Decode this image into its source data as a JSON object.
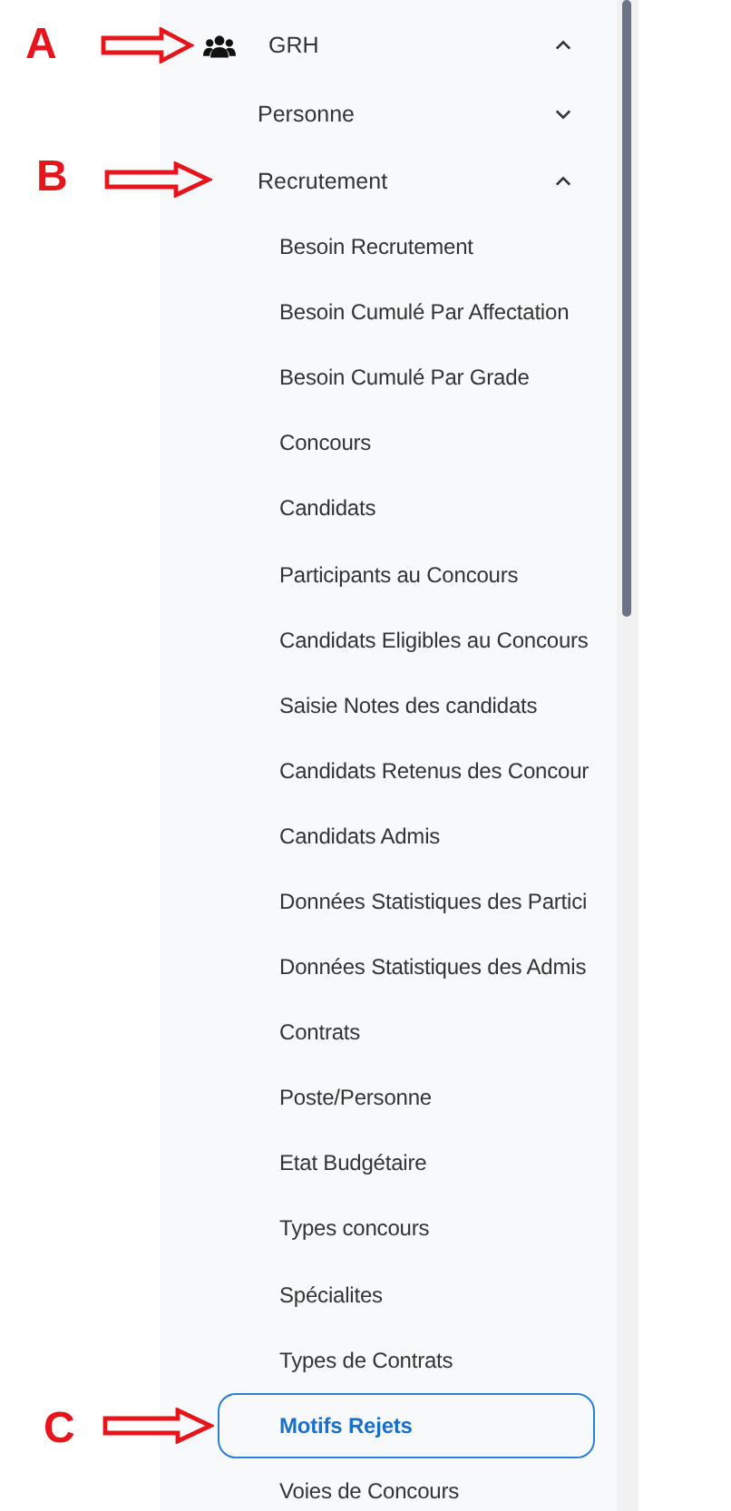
{
  "menu": {
    "label": "GRH",
    "expanded": true,
    "annotation": "A",
    "children": [
      {
        "label": "Personne",
        "expanded": false
      },
      {
        "label": "Recrutement",
        "expanded": true,
        "annotation": "B",
        "children": [
          {
            "label": "Besoin Recrutement",
            "selected": false
          },
          {
            "label": "Besoin Cumulé Par Affectation",
            "selected": false
          },
          {
            "label": "Besoin Cumulé Par Grade",
            "selected": false
          },
          {
            "label": "Concours",
            "selected": false
          },
          {
            "label": "Candidats",
            "selected": false
          },
          {
            "label": "Participants au Concours",
            "selected": false
          },
          {
            "label": "Candidats Eligibles au Concours",
            "selected": false
          },
          {
            "label": "Saisie Notes des candidats",
            "selected": false
          },
          {
            "label": "Candidats Retenus des Concour",
            "selected": false
          },
          {
            "label": "Candidats Admis",
            "selected": false
          },
          {
            "label": "Données Statistiques des Partici",
            "selected": false
          },
          {
            "label": "Données Statistiques des Admis",
            "selected": false
          },
          {
            "label": "Contrats",
            "selected": false
          },
          {
            "label": "Poste/Personne",
            "selected": false
          },
          {
            "label": "Etat Budgétaire",
            "selected": false
          },
          {
            "label": "Types concours",
            "selected": false
          },
          {
            "label": "Spécialites",
            "selected": false
          },
          {
            "label": "Types de Contrats",
            "selected": false
          },
          {
            "label": "Motifs Rejets",
            "selected": true,
            "annotation": "C"
          },
          {
            "label": "Voies de Concours",
            "selected": false
          }
        ]
      }
    ]
  }
}
